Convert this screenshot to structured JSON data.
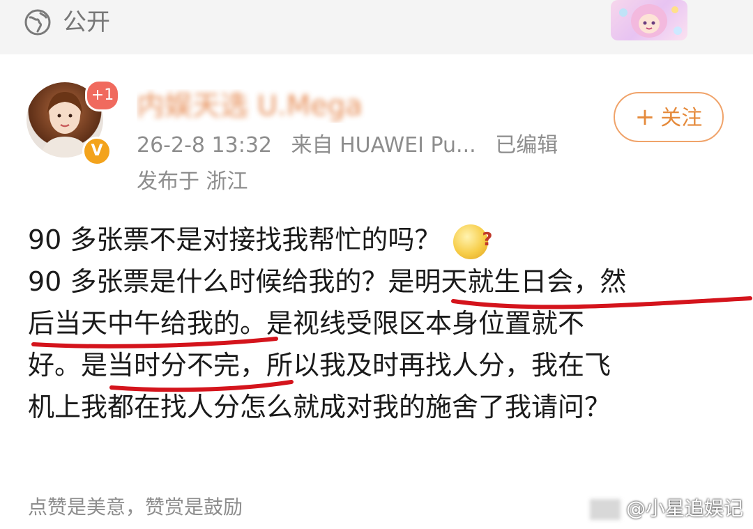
{
  "header": {
    "visibility_label": "公开",
    "visibility_icon": "globe-icon"
  },
  "author": {
    "name": "内娱天选 U.Mega",
    "avatar_badge": "+1",
    "verified_badge": "V",
    "timestamp": "26-2-8 13:32",
    "source": "来自 HUAWEI Pu...",
    "edited": "已编辑",
    "location": "发布于 浙江"
  },
  "follow_button": {
    "plus": "+",
    "label": "关注"
  },
  "post": {
    "lines": [
      "90 多张票不是对接找我帮忙的吗？",
      "90 多张票是什么时候给我的？是明天就生日会，然",
      "后当天中午给我的。是视线受限区本身位置就不",
      "好。是当时分不完，所以我及时再找人分，我在飞",
      "机上我都在找人分怎么就成对我的施舍了我请问？"
    ],
    "emoji": "thinking-emoji-icon"
  },
  "footer": {
    "tip_text": "点赞是美意，赞赏是鼓励"
  },
  "watermark": {
    "text": "@小星追娱记"
  },
  "colors": {
    "accent_orange": "#e58a3b",
    "underline_red": "#d4141c",
    "meta_gray": "#8d8d8d"
  }
}
